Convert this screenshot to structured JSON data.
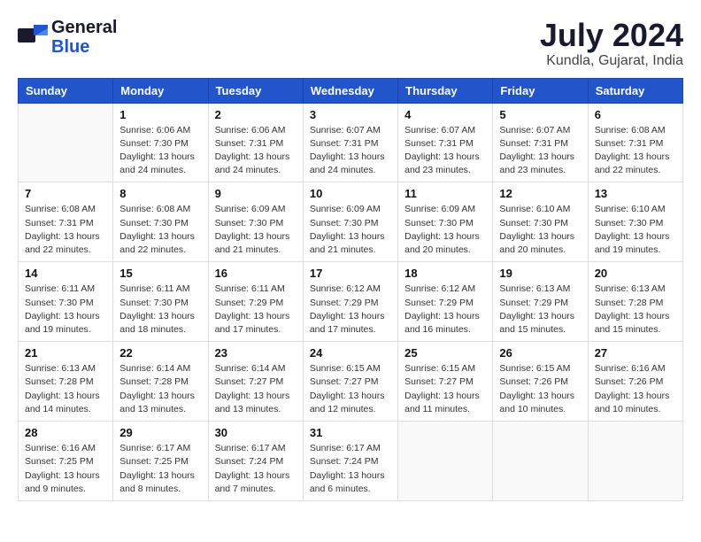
{
  "header": {
    "logo_general": "General",
    "logo_blue": "Blue",
    "month_year": "July 2024",
    "location": "Kundla, Gujarat, India"
  },
  "weekdays": [
    "Sunday",
    "Monday",
    "Tuesday",
    "Wednesday",
    "Thursday",
    "Friday",
    "Saturday"
  ],
  "weeks": [
    [
      {
        "day": "",
        "info": ""
      },
      {
        "day": "1",
        "info": "Sunrise: 6:06 AM\nSunset: 7:30 PM\nDaylight: 13 hours\nand 24 minutes."
      },
      {
        "day": "2",
        "info": "Sunrise: 6:06 AM\nSunset: 7:31 PM\nDaylight: 13 hours\nand 24 minutes."
      },
      {
        "day": "3",
        "info": "Sunrise: 6:07 AM\nSunset: 7:31 PM\nDaylight: 13 hours\nand 24 minutes."
      },
      {
        "day": "4",
        "info": "Sunrise: 6:07 AM\nSunset: 7:31 PM\nDaylight: 13 hours\nand 23 minutes."
      },
      {
        "day": "5",
        "info": "Sunrise: 6:07 AM\nSunset: 7:31 PM\nDaylight: 13 hours\nand 23 minutes."
      },
      {
        "day": "6",
        "info": "Sunrise: 6:08 AM\nSunset: 7:31 PM\nDaylight: 13 hours\nand 22 minutes."
      }
    ],
    [
      {
        "day": "7",
        "info": "Sunrise: 6:08 AM\nSunset: 7:31 PM\nDaylight: 13 hours\nand 22 minutes."
      },
      {
        "day": "8",
        "info": "Sunrise: 6:08 AM\nSunset: 7:30 PM\nDaylight: 13 hours\nand 22 minutes."
      },
      {
        "day": "9",
        "info": "Sunrise: 6:09 AM\nSunset: 7:30 PM\nDaylight: 13 hours\nand 21 minutes."
      },
      {
        "day": "10",
        "info": "Sunrise: 6:09 AM\nSunset: 7:30 PM\nDaylight: 13 hours\nand 21 minutes."
      },
      {
        "day": "11",
        "info": "Sunrise: 6:09 AM\nSunset: 7:30 PM\nDaylight: 13 hours\nand 20 minutes."
      },
      {
        "day": "12",
        "info": "Sunrise: 6:10 AM\nSunset: 7:30 PM\nDaylight: 13 hours\nand 20 minutes."
      },
      {
        "day": "13",
        "info": "Sunrise: 6:10 AM\nSunset: 7:30 PM\nDaylight: 13 hours\nand 19 minutes."
      }
    ],
    [
      {
        "day": "14",
        "info": "Sunrise: 6:11 AM\nSunset: 7:30 PM\nDaylight: 13 hours\nand 19 minutes."
      },
      {
        "day": "15",
        "info": "Sunrise: 6:11 AM\nSunset: 7:30 PM\nDaylight: 13 hours\nand 18 minutes."
      },
      {
        "day": "16",
        "info": "Sunrise: 6:11 AM\nSunset: 7:29 PM\nDaylight: 13 hours\nand 17 minutes."
      },
      {
        "day": "17",
        "info": "Sunrise: 6:12 AM\nSunset: 7:29 PM\nDaylight: 13 hours\nand 17 minutes."
      },
      {
        "day": "18",
        "info": "Sunrise: 6:12 AM\nSunset: 7:29 PM\nDaylight: 13 hours\nand 16 minutes."
      },
      {
        "day": "19",
        "info": "Sunrise: 6:13 AM\nSunset: 7:29 PM\nDaylight: 13 hours\nand 15 minutes."
      },
      {
        "day": "20",
        "info": "Sunrise: 6:13 AM\nSunset: 7:28 PM\nDaylight: 13 hours\nand 15 minutes."
      }
    ],
    [
      {
        "day": "21",
        "info": "Sunrise: 6:13 AM\nSunset: 7:28 PM\nDaylight: 13 hours\nand 14 minutes."
      },
      {
        "day": "22",
        "info": "Sunrise: 6:14 AM\nSunset: 7:28 PM\nDaylight: 13 hours\nand 13 minutes."
      },
      {
        "day": "23",
        "info": "Sunrise: 6:14 AM\nSunset: 7:27 PM\nDaylight: 13 hours\nand 13 minutes."
      },
      {
        "day": "24",
        "info": "Sunrise: 6:15 AM\nSunset: 7:27 PM\nDaylight: 13 hours\nand 12 minutes."
      },
      {
        "day": "25",
        "info": "Sunrise: 6:15 AM\nSunset: 7:27 PM\nDaylight: 13 hours\nand 11 minutes."
      },
      {
        "day": "26",
        "info": "Sunrise: 6:15 AM\nSunset: 7:26 PM\nDaylight: 13 hours\nand 10 minutes."
      },
      {
        "day": "27",
        "info": "Sunrise: 6:16 AM\nSunset: 7:26 PM\nDaylight: 13 hours\nand 10 minutes."
      }
    ],
    [
      {
        "day": "28",
        "info": "Sunrise: 6:16 AM\nSunset: 7:25 PM\nDaylight: 13 hours\nand 9 minutes."
      },
      {
        "day": "29",
        "info": "Sunrise: 6:17 AM\nSunset: 7:25 PM\nDaylight: 13 hours\nand 8 minutes."
      },
      {
        "day": "30",
        "info": "Sunrise: 6:17 AM\nSunset: 7:24 PM\nDaylight: 13 hours\nand 7 minutes."
      },
      {
        "day": "31",
        "info": "Sunrise: 6:17 AM\nSunset: 7:24 PM\nDaylight: 13 hours\nand 6 minutes."
      },
      {
        "day": "",
        "info": ""
      },
      {
        "day": "",
        "info": ""
      },
      {
        "day": "",
        "info": ""
      }
    ]
  ]
}
